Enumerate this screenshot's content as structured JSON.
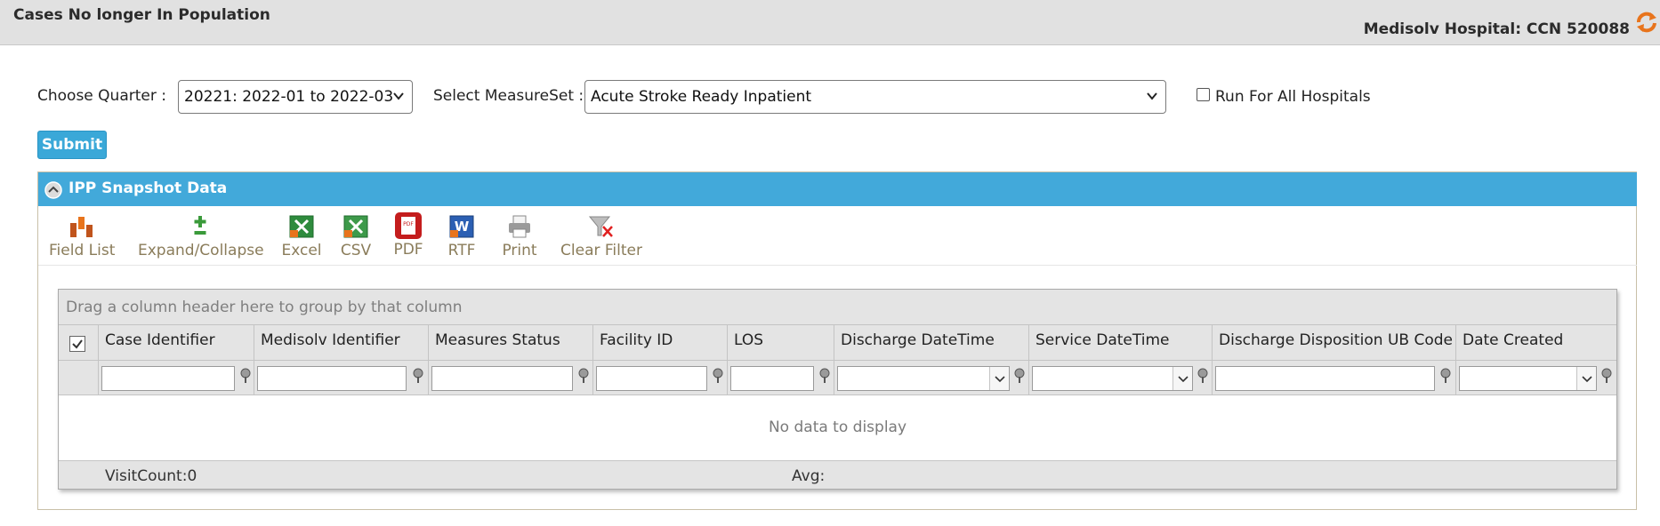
{
  "header": {
    "page_title": "Cases No longer In Population",
    "hospital": "Medisolv Hospital: CCN 520088"
  },
  "criteria": {
    "quarter_label": "Choose Quarter :",
    "quarter_value": "20221: 2022-01 to 2022-03",
    "measureset_label": "Select MeasureSet :",
    "measureset_value": "Acute Stroke Ready Inpatient",
    "run_all_label": "Run For All Hospitals",
    "run_all_checked": false,
    "submit_label": "Submit"
  },
  "panel": {
    "title": "IPP Snapshot Data",
    "toolbar": [
      {
        "label": "Field List",
        "icon": "field-list-icon"
      },
      {
        "label": "Expand/Collapse",
        "icon": "expand-collapse-icon"
      },
      {
        "label": "Excel",
        "icon": "excel-icon"
      },
      {
        "label": "CSV",
        "icon": "csv-icon"
      },
      {
        "label": "PDF",
        "icon": "pdf-icon"
      },
      {
        "label": "RTF",
        "icon": "rtf-icon"
      },
      {
        "label": "Print",
        "icon": "print-icon"
      },
      {
        "label": "Clear Filter",
        "icon": "clear-filter-icon"
      }
    ]
  },
  "grid": {
    "group_hint": "Drag a column header here to group by that column",
    "columns": [
      "Case Identifier",
      "Medisolv Identifier",
      "Measures Status",
      "Facility ID",
      "LOS",
      "Discharge DateTime",
      "Service DateTime",
      "Discharge Disposition UB Code",
      "Date Created"
    ],
    "empty_text": "No data to display",
    "footer": {
      "visit_count": "VisitCount:0",
      "avg": "Avg:"
    }
  },
  "colors": {
    "accent": "#42a9da",
    "submit": "#3aa8d8",
    "toolbar_label": "#8a7c5a"
  }
}
